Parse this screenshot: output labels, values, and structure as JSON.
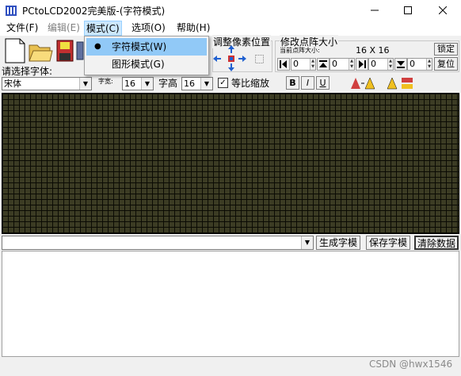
{
  "window": {
    "title": "PCtoLCD2002完美版-(字符模式)",
    "minimize_icon": "minimize-icon",
    "maximize_icon": "maximize-icon",
    "close_icon": "close-icon"
  },
  "menu": {
    "file": "文件(F)",
    "edit": "编辑(E)",
    "mode": "模式(C)",
    "options": "选项(O)",
    "help": "帮助(H)"
  },
  "mode_menu": {
    "items": [
      {
        "label": "字符模式(W)",
        "checked": true
      },
      {
        "label": "图形模式(G)",
        "checked": false
      }
    ]
  },
  "pixel_group": {
    "title": "调整像素位置"
  },
  "size_group": {
    "title": "修改点阵大小",
    "current_label": "当前点阵大小:",
    "current_value": "16 X 16",
    "lock_label": "锁定",
    "reset_label": "复位",
    "spin_values": [
      "0",
      "0",
      "0",
      "0"
    ]
  },
  "font": {
    "label": "请选择字体:",
    "selected": "宋体",
    "width_label": "字宽:",
    "width_value": "16",
    "height_label": "字高",
    "height_value": "16",
    "scale_label": "等比缩放",
    "scale_checked": true
  },
  "format": {
    "bold": "B",
    "italic": "I",
    "underline": "U"
  },
  "bottom": {
    "input_value": "",
    "generate_label": "生成字模",
    "save_label": "保存字模",
    "clear_label": "清除数据"
  },
  "output": {
    "text": ""
  },
  "watermark": "CSDN @hwx1546",
  "colors": {
    "grid_fill": "#3c3c24",
    "grid_line": "#0b0b04",
    "menu_highlight": "#91c9f7"
  }
}
